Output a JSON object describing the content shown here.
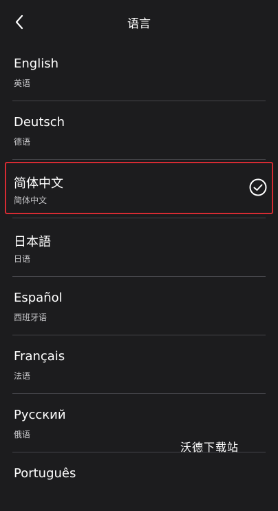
{
  "header": {
    "title": "语言",
    "back_icon": "chevron-left-icon"
  },
  "languages": [
    {
      "name": "English",
      "native": "英语",
      "selected": false
    },
    {
      "name": "Deutsch",
      "native": "德语",
      "selected": false
    },
    {
      "name": "简体中文",
      "native": "简体中文",
      "selected": true
    },
    {
      "name": "日本語",
      "native": "日语",
      "selected": false
    },
    {
      "name": "Español",
      "native": "西班牙语",
      "selected": false
    },
    {
      "name": "Français",
      "native": "法语",
      "selected": false
    },
    {
      "name": "Русский",
      "native": "俄语",
      "selected": false
    },
    {
      "name": "Português",
      "native": "",
      "selected": false
    }
  ],
  "selected_icon": "check-circle-icon",
  "watermark": "沃德下载站",
  "colors": {
    "background": "#1c1c1e",
    "highlight_border": "#d62b33",
    "divider": "#45454a"
  }
}
